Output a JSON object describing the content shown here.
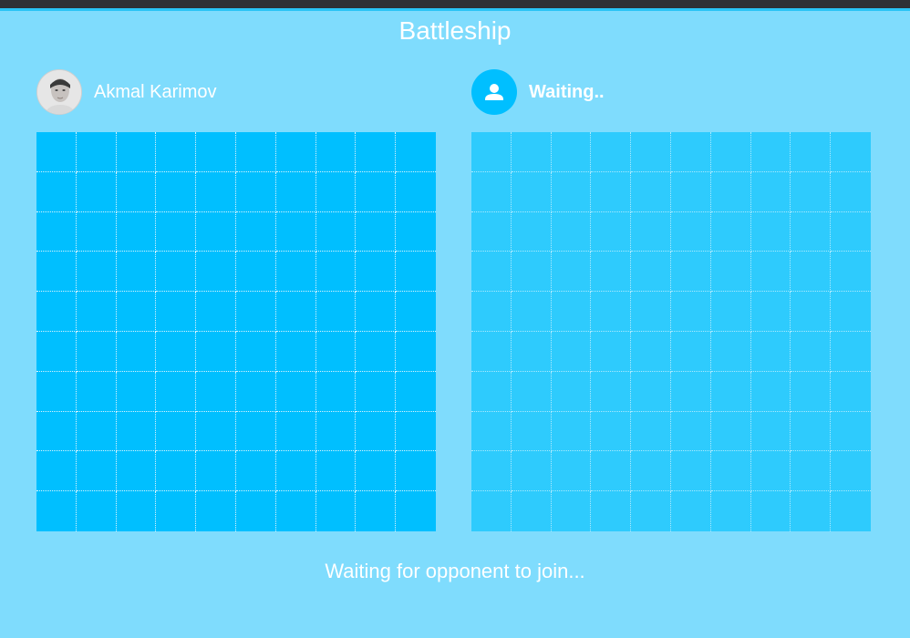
{
  "game": {
    "title": "Battleship",
    "status_message": "Waiting for opponent to join..."
  },
  "players": {
    "left": {
      "name": "Akmal Karimov",
      "avatar": "user-photo"
    },
    "right": {
      "name": "Waiting..",
      "avatar": "person-icon"
    }
  },
  "boards": {
    "rows": 10,
    "cols": 10,
    "left_color": "#00bfff",
    "right_color": "#2ecbfd"
  },
  "colors": {
    "background": "#7fdcfd",
    "accent": "#00bfff",
    "text": "#ffffff"
  }
}
